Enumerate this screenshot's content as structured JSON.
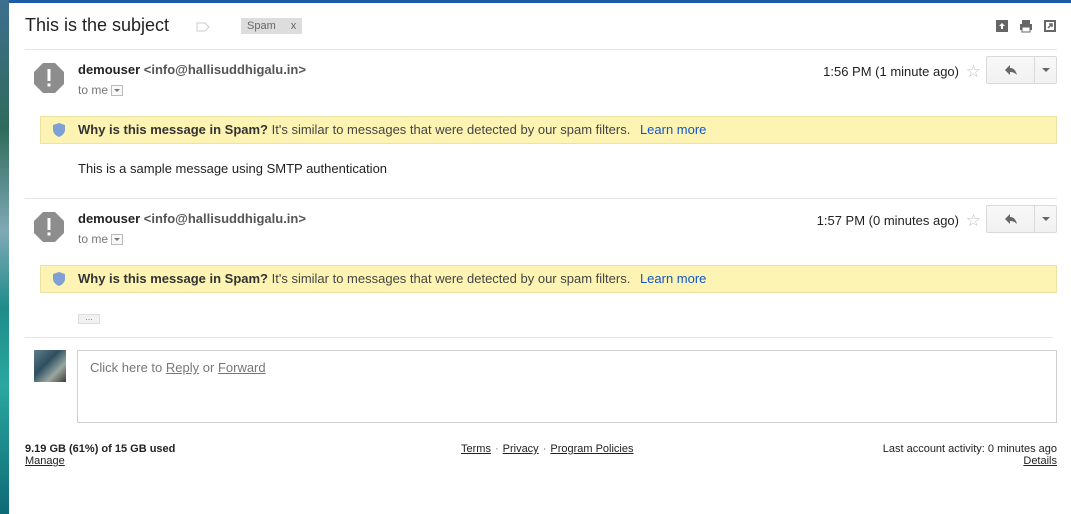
{
  "subject": "This is the subject",
  "spam_label": {
    "text": "Spam",
    "remove": "x"
  },
  "messages": [
    {
      "sender_name": "demouser",
      "sender_email": "<info@hallisuddhigalu.in>",
      "to": "to me",
      "time": "1:56 PM (1 minute ago)",
      "banner_title": "Why is this message in Spam?",
      "banner_text": "It's similar to messages that were detected by our spam filters.",
      "banner_link": "Learn more",
      "body": "This is a sample message using SMTP authentication"
    },
    {
      "sender_name": "demouser",
      "sender_email": "<info@hallisuddhigalu.in>",
      "to": "to me",
      "time": "1:57 PM (0 minutes ago)",
      "banner_title": "Why is this message in Spam?",
      "banner_text": "It's similar to messages that were detected by our spam filters.",
      "banner_link": "Learn more",
      "ellipsis": "..."
    }
  ],
  "reply_prompt": {
    "prefix": "Click here to",
    "reply": "Reply",
    "or": "or",
    "forward": "Forward"
  },
  "footer": {
    "quota": "9.19 GB (61%) of 15 GB used",
    "manage": "Manage",
    "links": [
      "Terms",
      "Privacy",
      "Program Policies"
    ],
    "activity": "Last account activity: 0 minutes ago",
    "details": "Details"
  },
  "colors": {
    "banner_bg": "#fdf4b4",
    "link": "#1155cc",
    "top_bar": "#1c5aa8"
  },
  "icons": [
    "label-icon",
    "archive-icon",
    "print-icon",
    "new-window-icon",
    "spam-warning-icon",
    "star-icon",
    "reply-icon",
    "shield-icon"
  ]
}
